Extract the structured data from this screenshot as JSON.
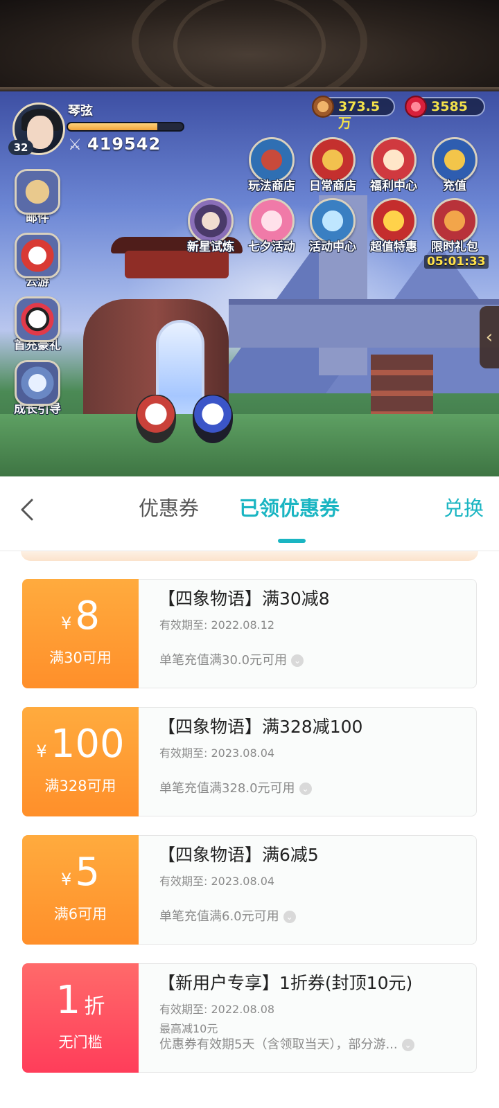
{
  "game": {
    "player": {
      "name": "琴弦",
      "level": "32",
      "xp_fraction": 0.78,
      "power": "419542"
    },
    "currencies": {
      "coins": "373.5万",
      "gems": "3585"
    },
    "side_buttons": [
      "邮件",
      "云游",
      "首充豪礼",
      "成长引导"
    ],
    "top_row_buttons": [
      "玩法商店",
      "日常商店",
      "福利中心",
      "充值"
    ],
    "second_row_buttons": [
      "新星试炼",
      "七夕活动",
      "活动中心",
      "超值特惠",
      "限时礼包"
    ],
    "timer": "05:01:33"
  },
  "nav": {
    "tab_coupons": "优惠券",
    "tab_claimed": "已领优惠券",
    "exchange": "兑换"
  },
  "coupons": [
    {
      "currency": "¥",
      "amount": "8",
      "condition": "满30可用",
      "title": "【四象物语】满30减8",
      "valid": "有效期至: 2022.08.12",
      "desc": "单笔充值满30.0元可用"
    },
    {
      "currency": "¥",
      "amount": "100",
      "condition": "满328可用",
      "title": "【四象物语】满328减100",
      "valid": "有效期至: 2023.08.04",
      "desc": "单笔充值满328.0元可用"
    },
    {
      "currency": "¥",
      "amount": "5",
      "condition": "满6可用",
      "title": "【四象物语】满6减5",
      "valid": "有效期至: 2023.08.04",
      "desc": "单笔充值满6.0元可用"
    },
    {
      "amount": "1",
      "unit": "折",
      "condition": "无门槛",
      "title": "【新用户专享】1折券(封顶10元)",
      "valid": "有效期至: 2022.08.08",
      "max": "最高减10元",
      "desc": "优惠券有效期5天（含领取当天），部分游..."
    }
  ],
  "colors": {
    "accent": "#1ab5c2",
    "coupon_orange": "#ff9a33",
    "coupon_red": "#ff4d5e"
  }
}
